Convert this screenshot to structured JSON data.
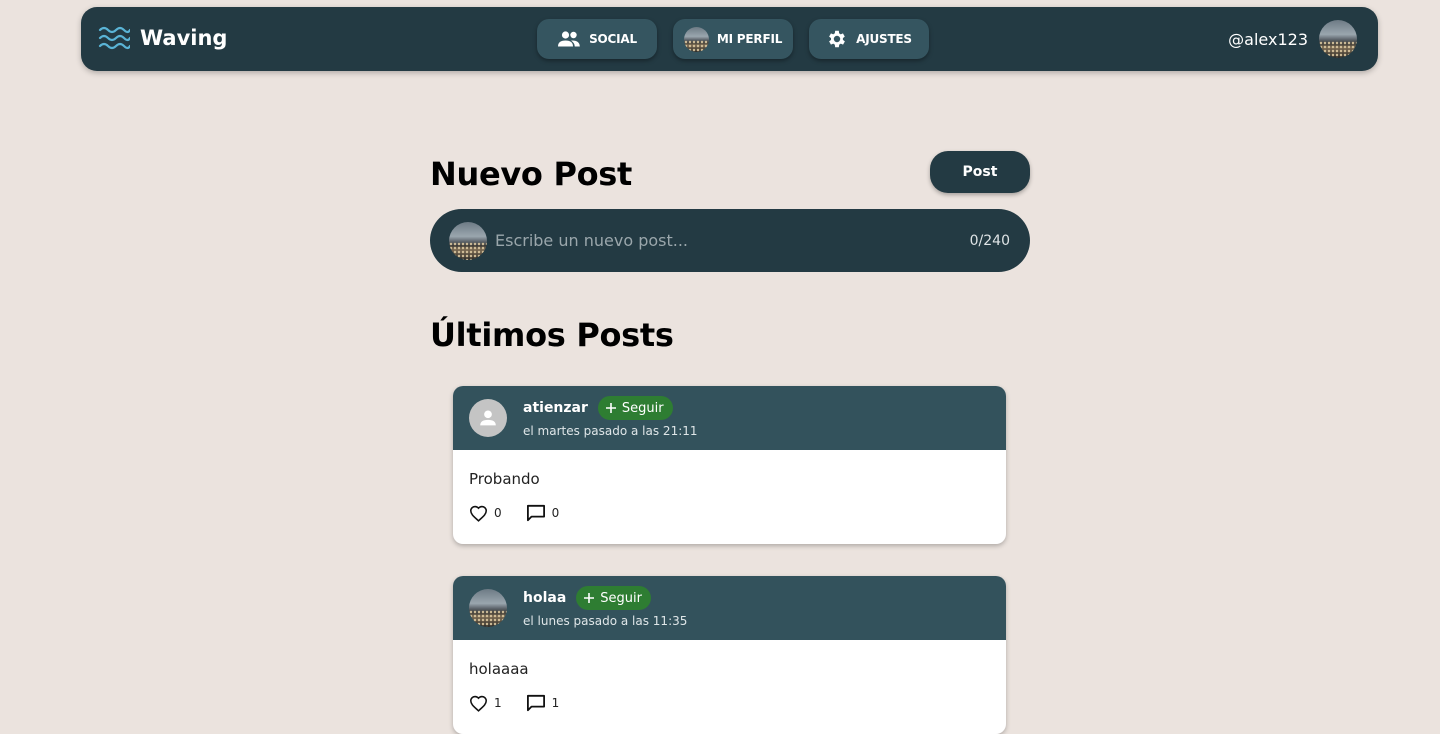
{
  "app": {
    "name": "Waving"
  },
  "nav": {
    "tabs": [
      {
        "label": "SOCIAL",
        "icon": "people-icon"
      },
      {
        "label": "MI PERFIL",
        "icon": "profile-avatar"
      },
      {
        "label": "AJUSTES",
        "icon": "gear-icon"
      }
    ],
    "user_handle": "@alex123"
  },
  "composer": {
    "title": "Nuevo Post",
    "post_button_label": "Post",
    "placeholder": "Escribe un nuevo post...",
    "char_count": "0/240"
  },
  "feed": {
    "title": "Últimos Posts",
    "posts": [
      {
        "username": "atienzar",
        "follow_label": "Seguir",
        "time": "el martes pasado a las 21:11",
        "text": "Probando",
        "likes": "0",
        "comments": "0",
        "avatar": "default-person-icon"
      },
      {
        "username": "holaa",
        "follow_label": "Seguir",
        "time": "el lunes pasado a las 11:35",
        "text": "holaaaa",
        "likes": "1",
        "comments": "1",
        "avatar": "photo-avatar"
      }
    ]
  },
  "colors": {
    "background": "#ebe3de",
    "navbar": "#233a43",
    "nav_button": "#355560",
    "post_header": "#33525c",
    "follow": "#2e7d32",
    "brand_icon": "#5ab4d6"
  }
}
